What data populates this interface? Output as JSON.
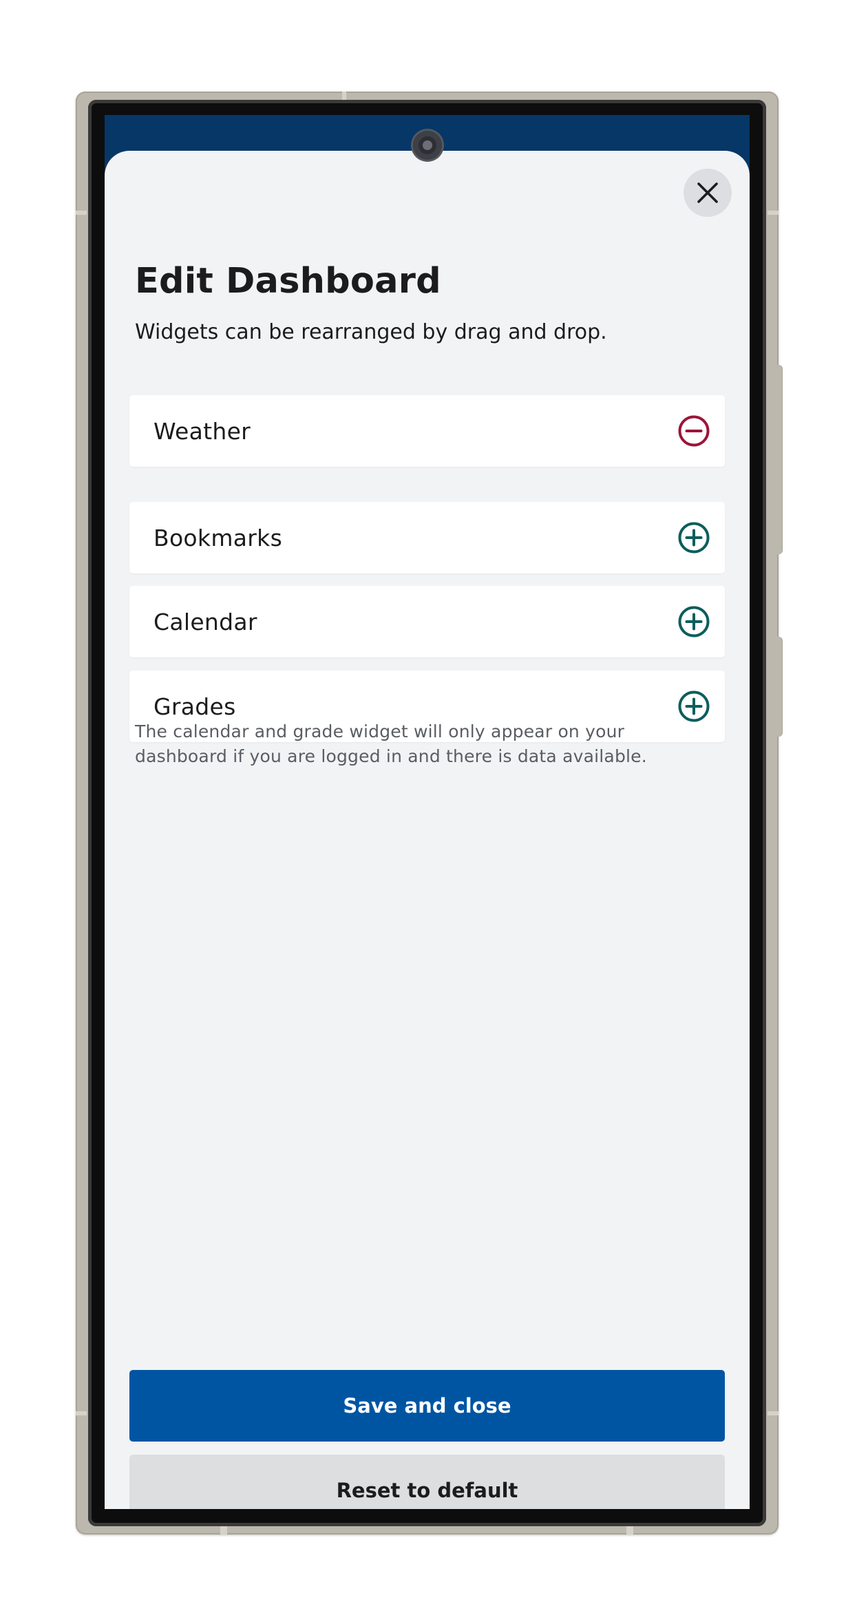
{
  "app": {
    "accent_color": "#0055a2",
    "header_color": "#063767"
  },
  "sheet": {
    "close_icon": "close-icon",
    "title": "Edit Dashboard",
    "subtitle": "Widgets can be rearranged by drag and drop."
  },
  "active_widgets": [
    {
      "label": "Weather",
      "action_icon": "minus-circle-icon",
      "action_color": "#9b1538"
    }
  ],
  "available_widgets": [
    {
      "label": "Bookmarks",
      "action_icon": "plus-circle-icon",
      "action_color": "#0b5e5c"
    },
    {
      "label": "Calendar",
      "action_icon": "plus-circle-icon",
      "action_color": "#0b5e5c"
    },
    {
      "label": "Grades",
      "action_icon": "plus-circle-icon",
      "action_color": "#0b5e5c"
    }
  ],
  "footnote": "The calendar and grade widget will only appear on your dashboard if you are logged in and there is data available.",
  "buttons": {
    "save_label": "Save and close",
    "reset_label": "Reset to default"
  }
}
